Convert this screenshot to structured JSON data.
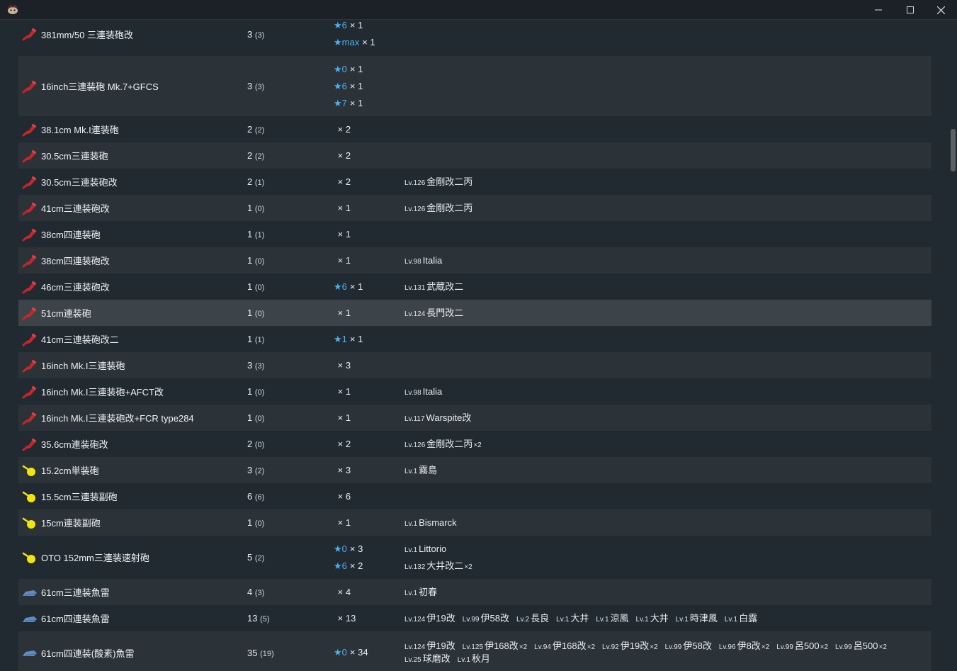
{
  "window": {
    "title_icon": "kancolle-app-icon",
    "controls": [
      "minimize-icon",
      "maximize-icon",
      "close-icon"
    ]
  },
  "colors": {
    "main_gun": "#c4262b",
    "secondary_gun": "#f1e60c",
    "torpedo": "#5d8cbd",
    "star": "#4ab2ef"
  },
  "rows": [
    {
      "icon": "main-gun-icon",
      "name": "381mm/50 三連装砲改",
      "count": "3",
      "sub": "(3)",
      "stars": [
        {
          "s": "★6",
          "q": "× 1"
        },
        {
          "s": "★max",
          "q": "× 1"
        }
      ],
      "ships": [],
      "h": 62,
      "top": 0,
      "alt": false
    },
    {
      "icon": "main-gun-icon",
      "name": "16inch三連装砲 Mk.7+GFCS",
      "count": "3",
      "sub": "(3)",
      "stars": [
        {
          "s": "★0",
          "q": "× 1"
        },
        {
          "s": "★6",
          "q": "× 1"
        },
        {
          "s": "★7",
          "q": "× 1"
        }
      ],
      "ships": [],
      "h": 85,
      "alt": true
    },
    {
      "icon": "main-gun-icon",
      "name": "38.1cm Mk.I連装砲",
      "count": "2",
      "sub": "(2)",
      "stars": [
        {
          "s": "",
          "q": "× 2"
        }
      ],
      "ships": [],
      "h": 37,
      "alt": false
    },
    {
      "icon": "main-gun-icon",
      "name": "30.5cm三連装砲",
      "count": "2",
      "sub": "(2)",
      "stars": [
        {
          "s": "",
          "q": "× 2"
        }
      ],
      "ships": [],
      "h": 37,
      "alt": true
    },
    {
      "icon": "main-gun-icon",
      "name": "30.5cm三連装砲改",
      "count": "2",
      "sub": "(1)",
      "stars": [
        {
          "s": "",
          "q": "× 2"
        }
      ],
      "ships": [
        {
          "lv": "Lv.126",
          "name": "金剛改二丙",
          "mult": ""
        }
      ],
      "h": 37,
      "alt": false
    },
    {
      "icon": "main-gun-icon",
      "name": "41cm三連装砲改",
      "count": "1",
      "sub": "(0)",
      "stars": [
        {
          "s": "",
          "q": "× 1"
        }
      ],
      "ships": [
        {
          "lv": "Lv.126",
          "name": "金剛改二丙",
          "mult": ""
        }
      ],
      "h": 37,
      "alt": true
    },
    {
      "icon": "main-gun-icon",
      "name": "38cm四連装砲",
      "count": "1",
      "sub": "(1)",
      "stars": [
        {
          "s": "",
          "q": "× 1"
        }
      ],
      "ships": [],
      "h": 37,
      "alt": false
    },
    {
      "icon": "main-gun-icon",
      "name": "38cm四連装砲改",
      "count": "1",
      "sub": "(0)",
      "stars": [
        {
          "s": "",
          "q": "× 1"
        }
      ],
      "ships": [
        {
          "lv": "Lv.98",
          "name": "Italia",
          "mult": ""
        }
      ],
      "h": 37,
      "alt": true
    },
    {
      "icon": "main-gun-icon",
      "name": "46cm三連装砲改",
      "count": "1",
      "sub": "(0)",
      "stars": [
        {
          "s": "★6",
          "q": "× 1"
        }
      ],
      "ships": [
        {
          "lv": "Lv.131",
          "name": "武蔵改二",
          "mult": ""
        }
      ],
      "h": 37,
      "alt": false
    },
    {
      "icon": "main-gun-icon",
      "name": "51cm連装砲",
      "count": "1",
      "sub": "(0)",
      "stars": [
        {
          "s": "",
          "q": "× 1"
        }
      ],
      "ships": [
        {
          "lv": "Lv.124",
          "name": "長門改二",
          "mult": ""
        }
      ],
      "h": 37,
      "alt": true,
      "hover": true
    },
    {
      "icon": "main-gun-icon",
      "name": "41cm三連装砲改二",
      "count": "1",
      "sub": "(1)",
      "stars": [
        {
          "s": "★1",
          "q": "× 1"
        }
      ],
      "ships": [],
      "h": 37,
      "alt": false
    },
    {
      "icon": "main-gun-icon",
      "name": "16inch Mk.I三連装砲",
      "count": "3",
      "sub": "(3)",
      "stars": [
        {
          "s": "",
          "q": "× 3"
        }
      ],
      "ships": [],
      "h": 37,
      "alt": true
    },
    {
      "icon": "main-gun-icon",
      "name": "16inch Mk.I三連装砲+AFCT改",
      "count": "1",
      "sub": "(0)",
      "stars": [
        {
          "s": "",
          "q": "× 1"
        }
      ],
      "ships": [
        {
          "lv": "Lv.98",
          "name": "Italia",
          "mult": ""
        }
      ],
      "h": 37,
      "alt": false
    },
    {
      "icon": "main-gun-icon",
      "name": "16inch Mk.I三連装砲改+FCR type284",
      "count": "1",
      "sub": "(0)",
      "stars": [
        {
          "s": "",
          "q": "× 1"
        }
      ],
      "ships": [
        {
          "lv": "Lv.117",
          "name": "Warspite改",
          "mult": ""
        }
      ],
      "h": 37,
      "alt": true
    },
    {
      "icon": "main-gun-icon",
      "name": "35.6cm連装砲改",
      "count": "2",
      "sub": "(0)",
      "stars": [
        {
          "s": "",
          "q": "× 2"
        }
      ],
      "ships": [
        {
          "lv": "Lv.126",
          "name": "金剛改二丙",
          "mult": "×2"
        }
      ],
      "h": 37,
      "alt": false
    },
    {
      "icon": "secondary-gun-icon",
      "name": "15.2cm単装砲",
      "count": "3",
      "sub": "(2)",
      "stars": [
        {
          "s": "",
          "q": "× 3"
        }
      ],
      "ships": [
        {
          "lv": "Lv.1",
          "name": "霧島",
          "mult": ""
        }
      ],
      "h": 37,
      "alt": true
    },
    {
      "icon": "secondary-gun-icon",
      "name": "15.5cm三連装副砲",
      "count": "6",
      "sub": "(6)",
      "stars": [
        {
          "s": "",
          "q": "× 6"
        }
      ],
      "ships": [],
      "h": 37,
      "alt": false
    },
    {
      "icon": "secondary-gun-icon",
      "name": "15cm連装副砲",
      "count": "1",
      "sub": "(0)",
      "stars": [
        {
          "s": "",
          "q": "× 1"
        }
      ],
      "ships": [
        {
          "lv": "Lv.1",
          "name": "Bismarck",
          "mult": ""
        }
      ],
      "h": 37,
      "alt": true
    },
    {
      "icon": "secondary-gun-icon",
      "name": "OTO 152mm三連装速射砲",
      "count": "5",
      "sub": "(2)",
      "stars": [
        {
          "s": "★0",
          "q": "× 3"
        },
        {
          "s": "★6",
          "q": "× 2"
        }
      ],
      "ships": [
        {
          "lv": "Lv.1",
          "name": "Littorio",
          "mult": "",
          "break": true
        },
        {
          "lv": "Lv.132",
          "name": "大井改二",
          "mult": "×2"
        }
      ],
      "h": 61,
      "alt": false
    },
    {
      "icon": "torpedo-icon",
      "name": "61cm三連装魚雷",
      "count": "4",
      "sub": "(3)",
      "stars": [
        {
          "s": "",
          "q": "× 4"
        }
      ],
      "ships": [
        {
          "lv": "Lv.1",
          "name": "初春",
          "mult": ""
        }
      ],
      "h": 37,
      "alt": true
    },
    {
      "icon": "torpedo-icon",
      "name": "61cm四連装魚雷",
      "count": "13",
      "sub": "(5)",
      "stars": [
        {
          "s": "",
          "q": "× 13"
        }
      ],
      "ships": [
        {
          "lv": "Lv.124",
          "name": "伊19改",
          "mult": ""
        },
        {
          "lv": "Lv.99",
          "name": "伊58改",
          "mult": ""
        },
        {
          "lv": "Lv.2",
          "name": "長良",
          "mult": ""
        },
        {
          "lv": "Lv.1",
          "name": "大井",
          "mult": ""
        },
        {
          "lv": "Lv.1",
          "name": "涼風",
          "mult": ""
        },
        {
          "lv": "Lv.1",
          "name": "大井",
          "mult": ""
        },
        {
          "lv": "Lv.1",
          "name": "時津風",
          "mult": ""
        },
        {
          "lv": "Lv.1",
          "name": "白露",
          "mult": ""
        }
      ],
      "h": 37,
      "alt": false
    },
    {
      "icon": "torpedo-icon",
      "name": "61cm四連装(酸素)魚雷",
      "count": "35",
      "sub": "(19)",
      "stars": [
        {
          "s": "★0",
          "q": "× 34"
        }
      ],
      "ships": [
        {
          "lv": "Lv.124",
          "name": "伊19改",
          "mult": ""
        },
        {
          "lv": "Lv.125",
          "name": "伊168改",
          "mult": "×2"
        },
        {
          "lv": "Lv.94",
          "name": "伊168改",
          "mult": "×2"
        },
        {
          "lv": "Lv.92",
          "name": "伊19改",
          "mult": "×2"
        },
        {
          "lv": "Lv.99",
          "name": "伊58改",
          "mult": ""
        },
        {
          "lv": "Lv.96",
          "name": "伊8改",
          "mult": "×2"
        },
        {
          "lv": "Lv.99",
          "name": "呂500",
          "mult": "×2"
        },
        {
          "lv": "Lv.99",
          "name": "呂500",
          "mult": "×2"
        },
        {
          "lv": "Lv.25",
          "name": "球磨改",
          "mult": ""
        },
        {
          "lv": "Lv.1",
          "name": "秋月",
          "mult": ""
        }
      ],
      "h": 60,
      "alt": true,
      "compact": true
    }
  ]
}
